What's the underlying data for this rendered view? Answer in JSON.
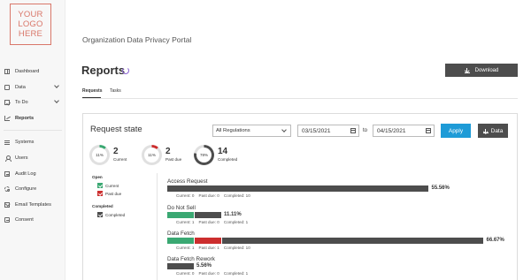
{
  "app": {
    "logo_text": "YOUR\nLOGO\nHERE",
    "portal_title": "Organization Data Privacy Portal",
    "page_title": "Reports"
  },
  "colors": {
    "current": "#3aa872",
    "past_due": "#cc2e2e",
    "completed": "#4d4d4d",
    "accent": "#1e9bd7",
    "logo": "#d9776a"
  },
  "sidebar": {
    "items": [
      {
        "label": "Dashboard",
        "icon": "grid-icon",
        "has_chevron": false,
        "active": false
      },
      {
        "label": "Data",
        "icon": "doc-icon",
        "has_chevron": true,
        "active": false
      },
      {
        "label": "To Do",
        "icon": "checkbox-icon",
        "has_chevron": true,
        "active": false
      },
      {
        "label": "Reports",
        "icon": "chart-icon",
        "has_chevron": false,
        "active": true
      },
      {
        "label": "Systems",
        "icon": "bars-icon",
        "has_chevron": false,
        "active": false
      },
      {
        "label": "Users",
        "icon": "user-icon",
        "has_chevron": false,
        "active": false
      },
      {
        "label": "Audit Log",
        "icon": "list-icon",
        "has_chevron": false,
        "active": false
      },
      {
        "label": "Configure",
        "icon": "gear-icon",
        "has_chevron": false,
        "active": false
      },
      {
        "label": "Email Templates",
        "icon": "mail-icon",
        "has_chevron": false,
        "active": false
      },
      {
        "label": "Consent",
        "icon": "consent-icon",
        "has_chevron": false,
        "active": false
      }
    ]
  },
  "toolbar": {
    "download_label": "Download"
  },
  "tabs": [
    {
      "label": "Requests",
      "active": true
    },
    {
      "label": "Tasks",
      "active": false
    }
  ],
  "panel": {
    "title": "Request state",
    "regulation_select": "All Regulations",
    "date_from": "03/15/2021",
    "to_label": "to",
    "date_to": "04/15/2021",
    "apply_label": "Apply",
    "data_label": "Data"
  },
  "stats": [
    {
      "percent_label": "11%",
      "percent": 11,
      "value": "2",
      "label": "Current",
      "color_key": "current"
    },
    {
      "percent_label": "11%",
      "percent": 11,
      "value": "2",
      "label": "Past due",
      "color_key": "past_due"
    },
    {
      "percent_label": "78%",
      "percent": 78,
      "value": "14",
      "label": "Completed",
      "color_key": "completed"
    }
  ],
  "legend": {
    "open_heading": "Open",
    "current_label": "Current",
    "past_due_label": "Past due",
    "completed_heading": "Completed",
    "completed_label": "Completed"
  },
  "chart_data": {
    "type": "bar",
    "categories": [
      "Access Request",
      "Do Not Sell",
      "Data Fetch",
      "Data Fetch Rework"
    ],
    "series": [
      {
        "name": "Current",
        "values": [
          0,
          1,
          1,
          0
        ]
      },
      {
        "name": "Past due",
        "values": [
          0,
          0,
          1,
          0
        ]
      },
      {
        "name": "Completed",
        "values": [
          10,
          1,
          10,
          1
        ]
      }
    ],
    "percent_labels": [
      "55.56%",
      "11.11%",
      "66.67%",
      "5.56%"
    ],
    "captions": [
      "Current: 0    Past due: 0    Completed: 10",
      "Current: 1    Past due: 0    Completed: 1",
      "Current: 1    Past due: 1    Completed: 10",
      "Current: 0    Past due: 0    Completed: 1"
    ]
  }
}
